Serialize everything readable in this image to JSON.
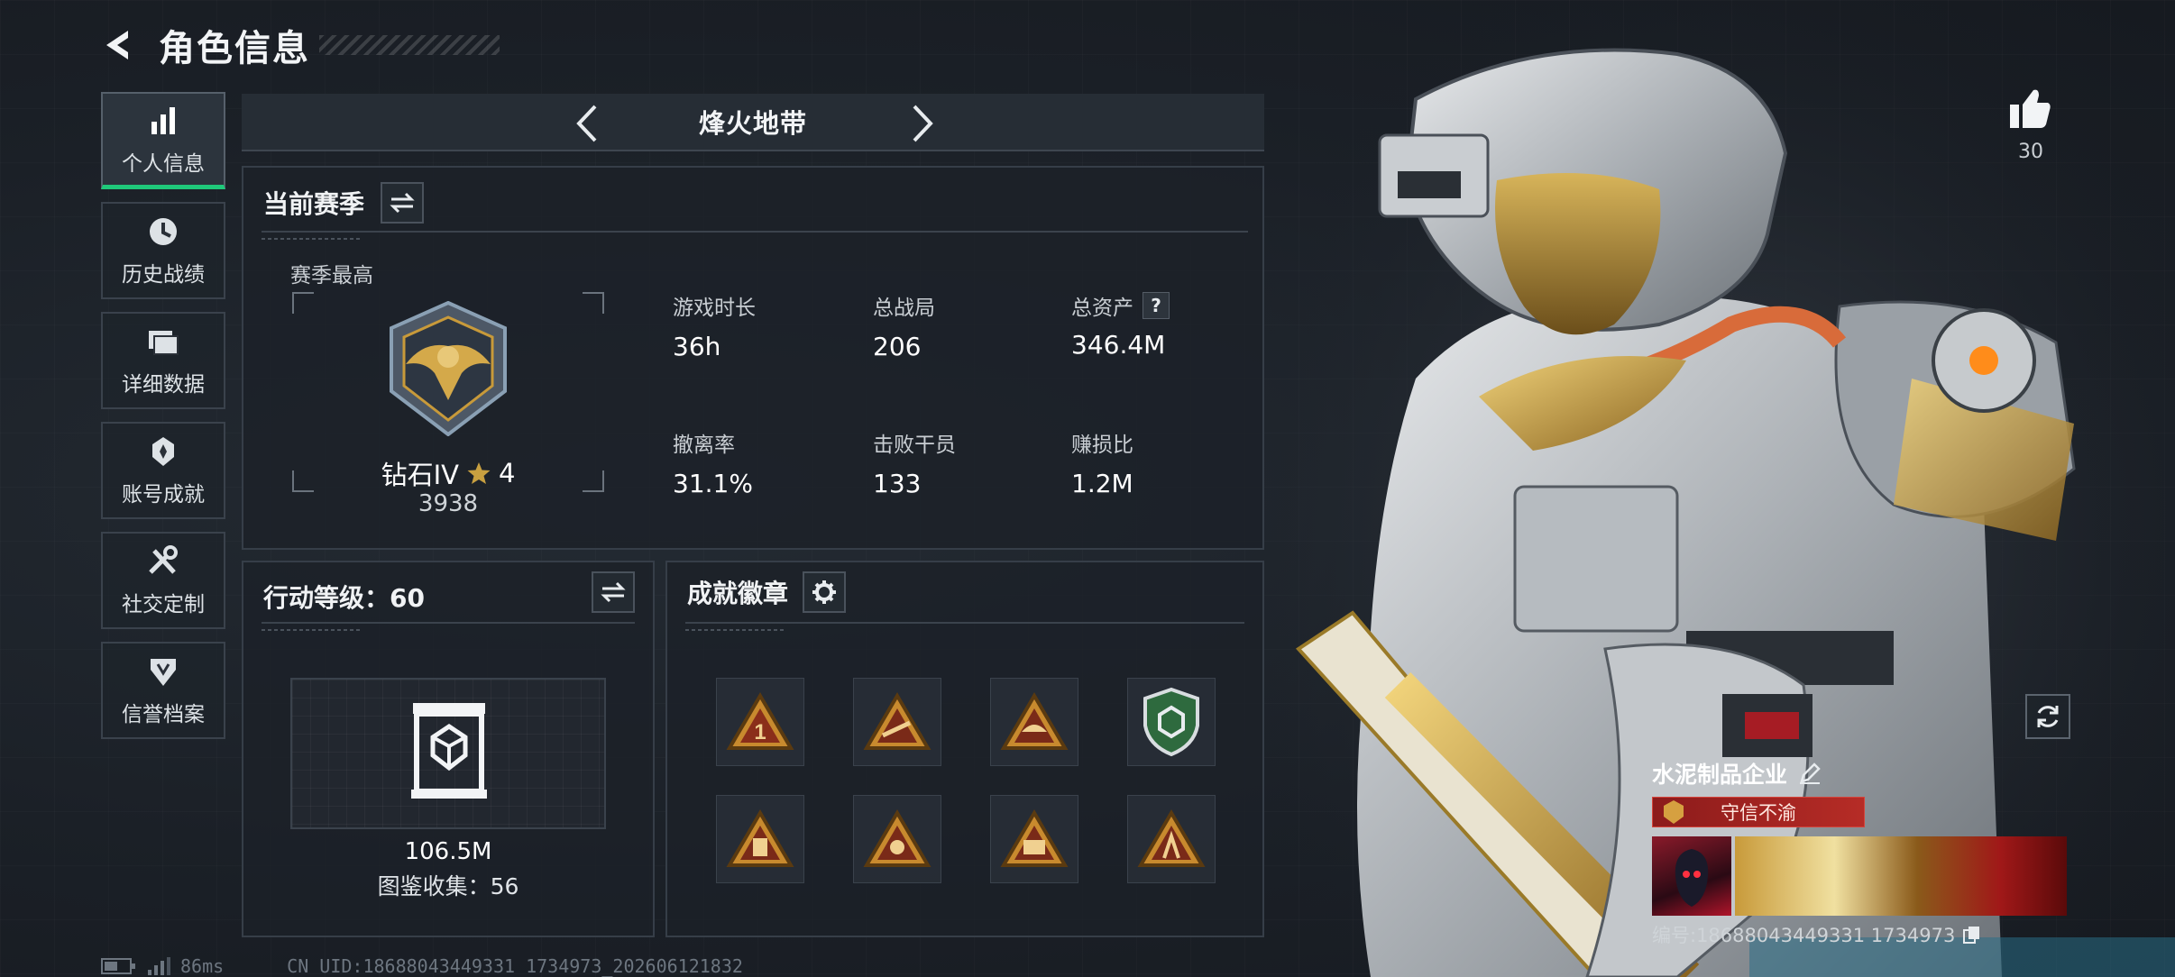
{
  "header": {
    "title": "角色信息"
  },
  "sidebar": {
    "items": [
      {
        "label": "个人信息",
        "icon": "bar-chart-icon",
        "active": true
      },
      {
        "label": "历史战绩",
        "icon": "history-icon",
        "active": false
      },
      {
        "label": "详细数据",
        "icon": "folder-icon",
        "active": false
      },
      {
        "label": "账号成就",
        "icon": "achievement-icon",
        "active": false
      },
      {
        "label": "社交定制",
        "icon": "tools-icon",
        "active": false
      },
      {
        "label": "信誉档案",
        "icon": "reputation-icon",
        "active": false
      }
    ]
  },
  "mode": {
    "title": "烽火地带"
  },
  "season": {
    "title": "当前赛季",
    "best_label": "赛季最高",
    "rank_name": "钻石IV",
    "rank_stars": "4",
    "rank_score": "3938",
    "stats": [
      {
        "label": "游戏时长",
        "value": "36h"
      },
      {
        "label": "总战局",
        "value": "206"
      },
      {
        "label": "总资产",
        "value": "346.4M",
        "has_help": true
      },
      {
        "label": "撤离率",
        "value": "31.1%"
      },
      {
        "label": "击败干员",
        "value": "133"
      },
      {
        "label": "赚损比",
        "value": "1.2M"
      }
    ]
  },
  "action_level": {
    "title": "行动等级：60",
    "value": "106.5M",
    "collection": "图鉴收集：56"
  },
  "achievements": {
    "title": "成就徽章",
    "badges": [
      "badge-1",
      "badge-2",
      "badge-3",
      "badge-4",
      "badge-5",
      "badge-6",
      "badge-7",
      "badge-8"
    ]
  },
  "likes": {
    "count": "30"
  },
  "profile": {
    "name": "水泥制品企业",
    "reputation": "守信不渝",
    "id_line": "编号:18688043449331 1734973"
  },
  "status": {
    "ping": "86ms",
    "uid": "CN UID:18688043449331 1734973_202606121832"
  },
  "colors": {
    "accent": "#1fc97a",
    "gold": "#c89a3a",
    "rep_red": "#b62c26"
  }
}
